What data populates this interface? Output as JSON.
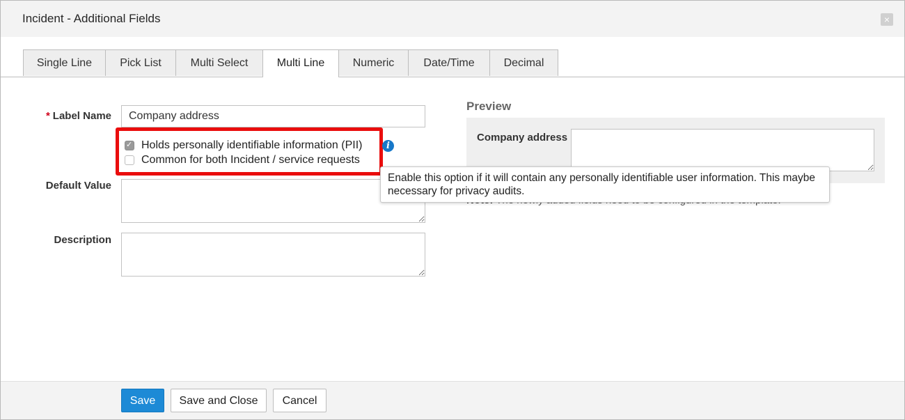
{
  "dialog": {
    "title": "Incident - Additional Fields",
    "close_icon": "×"
  },
  "tabs": [
    {
      "label": "Single Line",
      "active": false
    },
    {
      "label": "Pick List",
      "active": false
    },
    {
      "label": "Multi Select",
      "active": false
    },
    {
      "label": "Multi Line",
      "active": true
    },
    {
      "label": "Numeric",
      "active": false
    },
    {
      "label": "Date/Time",
      "active": false
    },
    {
      "label": "Decimal",
      "active": false
    }
  ],
  "form": {
    "label_name": {
      "label": "Label Name",
      "required_mark": "*",
      "value": "Company address"
    },
    "pii": {
      "label": "Holds personally identifiable information (PII)",
      "checked": true
    },
    "common": {
      "label": "Common for both Incident / service requests",
      "checked": false
    },
    "info_icon": "i",
    "default_value": {
      "label": "Default Value",
      "value": ""
    },
    "description": {
      "label": "Description",
      "value": ""
    }
  },
  "tooltip": {
    "text": "Enable this option if it will contain any personally identifiable user information. This maybe necessary for privacy audits."
  },
  "preview": {
    "heading": "Preview",
    "field_label": "Company address",
    "note_label": "Note:",
    "note_text": "The newly added fields need to be configured in the template."
  },
  "footer": {
    "save_label": "Save",
    "save_close_label": "Save and Close",
    "cancel_label": "Cancel"
  },
  "colors": {
    "primary_button": "#1d8ad6",
    "highlight_border": "#ea0d0d",
    "info_icon": "#1778c9",
    "required": "#d0021b"
  }
}
